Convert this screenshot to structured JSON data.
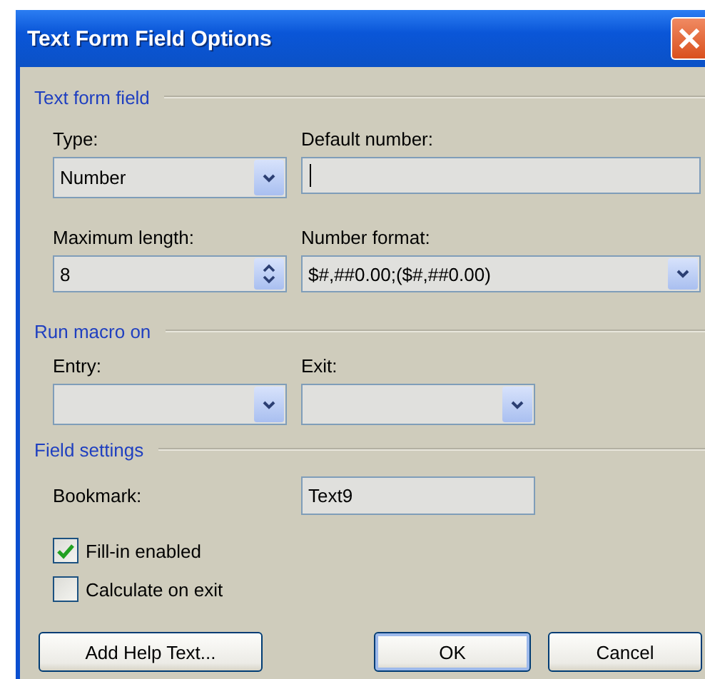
{
  "window": {
    "title": "Text Form Field Options"
  },
  "text_form_field": {
    "heading": "Text form field",
    "type": {
      "label": "Type:",
      "value": "Number"
    },
    "default_number": {
      "label": "Default number:",
      "focused": true
    },
    "maximum_length": {
      "label": "Maximum length:",
      "value": "8"
    },
    "number_format": {
      "label": "Number format:",
      "value": "$#,##0.00;($#,##0.00)"
    }
  },
  "run_macro_on": {
    "heading": "Run macro on",
    "entry": {
      "label": "Entry:"
    },
    "exit": {
      "label": "Exit:"
    }
  },
  "field_settings": {
    "heading": "Field settings",
    "bookmark": {
      "label": "Bookmark:",
      "value": "Text9"
    },
    "checkboxes": [
      {
        "label": "Fill-in enabled",
        "checked": true
      },
      {
        "label": "Calculate on exit",
        "checked": false
      }
    ]
  },
  "buttons": [
    {
      "label": "Add Help Text...",
      "default": false
    },
    {
      "label": "OK",
      "default": true
    },
    {
      "label": "Cancel",
      "default": false
    }
  ]
}
